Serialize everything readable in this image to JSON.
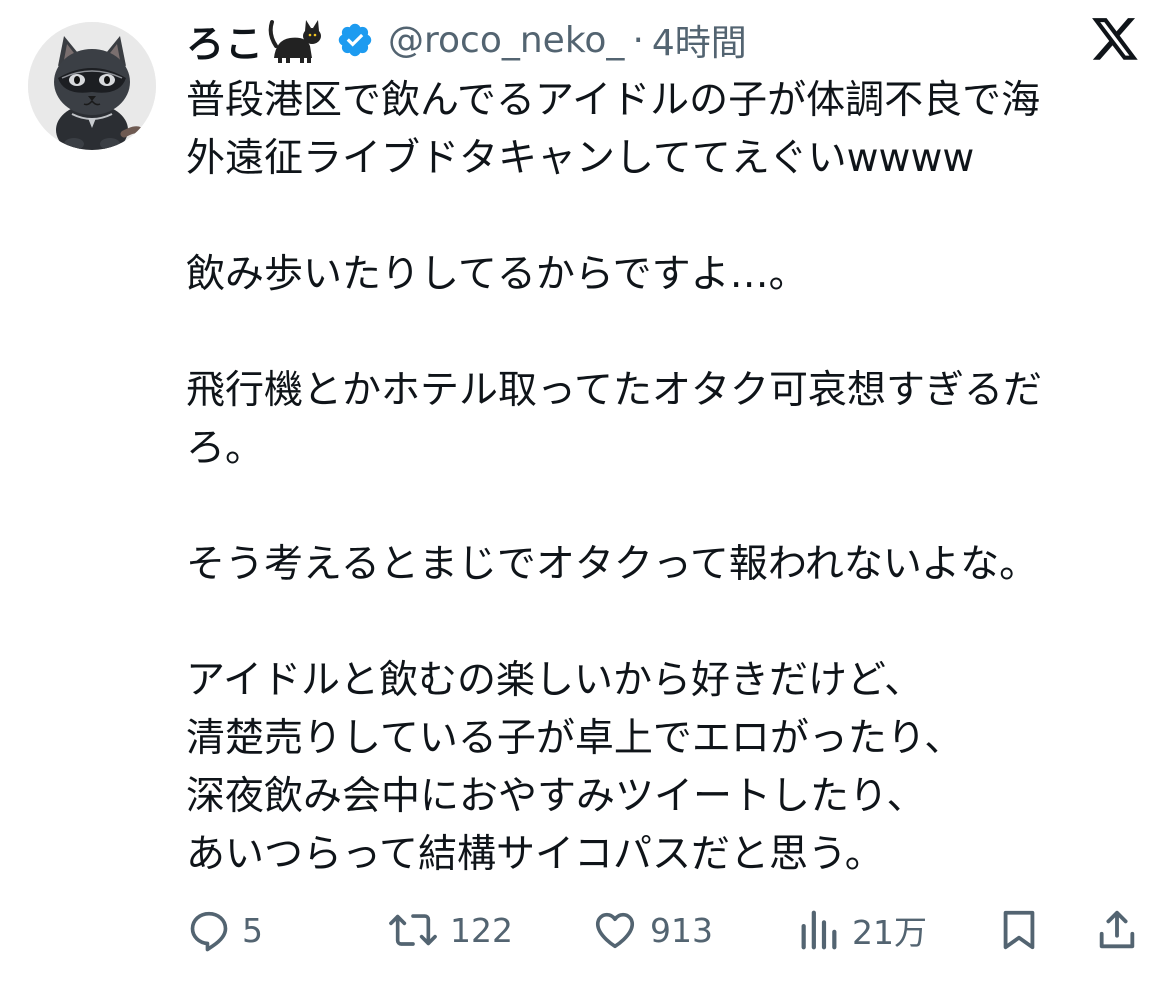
{
  "author": {
    "display_name": "ろこ",
    "handle": "@roco_neko_",
    "separator": "·",
    "time": "4時間",
    "verified": true,
    "name_emoji": "black-cat"
  },
  "tweet": {
    "paragraphs": [
      "普段港区で飲んでるアイドルの子が体調不良で海\n外遠征ライブドタキャンしててえぐいwwww",
      "飲み歩いたりしてるからですよ…。",
      "飛行機とかホテル取ってたオタク可哀想すぎるだ\nろ。",
      "そう考えるとまじでオタクって報われないよな。",
      "アイドルと飲むの楽しいから好きだけど、\n清楚売りしている子が卓上でエロがったり、\n深夜飲み会中におやすみツイートしたり、\nあいつらって結構サイコパスだと思う。"
    ]
  },
  "actions": {
    "replies": "5",
    "retweets": "122",
    "likes": "913",
    "views": "21万"
  },
  "icons": {
    "reply": "reply-icon",
    "retweet": "retweet-icon",
    "like": "heart-icon",
    "views": "views-bar-icon",
    "bookmark": "bookmark-icon",
    "share": "share-icon",
    "brand": "x-logo-icon"
  },
  "colors": {
    "text": "#0f1419",
    "secondary": "#536471",
    "verified": "#1d9bf0"
  }
}
